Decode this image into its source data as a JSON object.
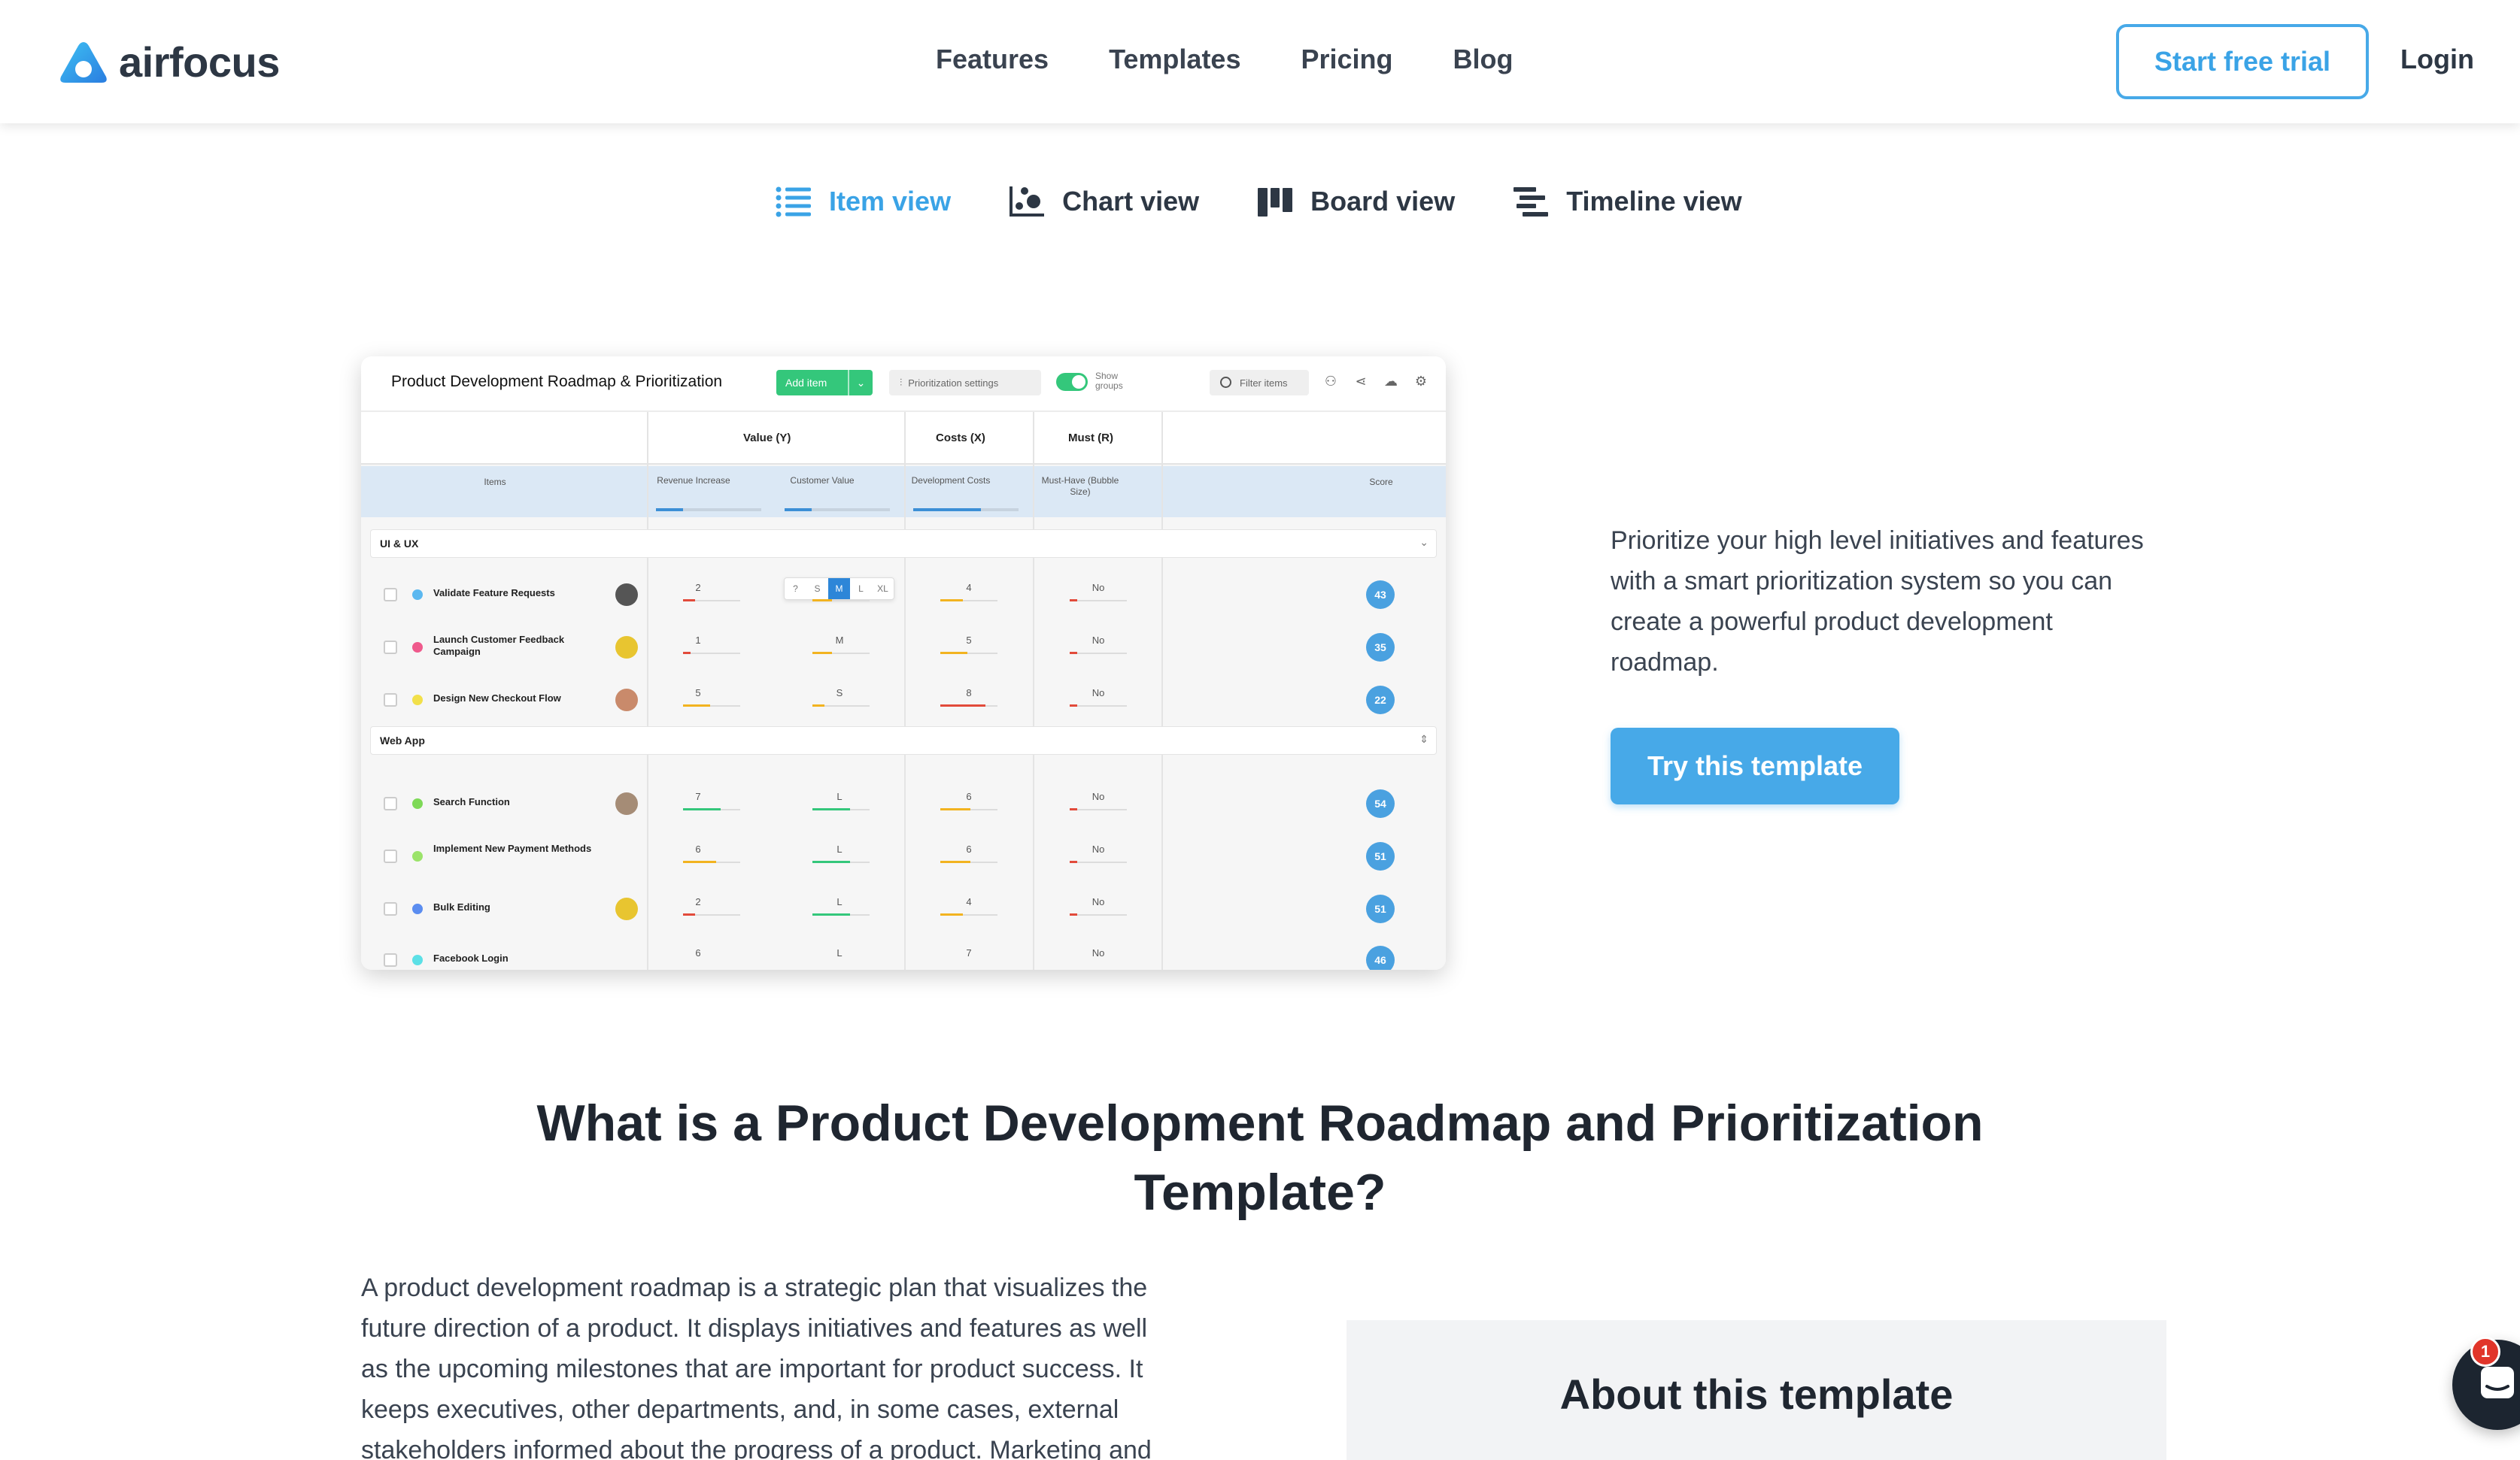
{
  "header": {
    "logo_text": "airfocus",
    "nav": [
      "Features",
      "Templates",
      "Pricing",
      "Blog"
    ],
    "cta": "Start free trial",
    "login": "Login"
  },
  "views": [
    {
      "label": "Item view",
      "icon": "list-icon",
      "active": true
    },
    {
      "label": "Chart view",
      "icon": "chart-icon",
      "active": false
    },
    {
      "label": "Board view",
      "icon": "board-icon",
      "active": false
    },
    {
      "label": "Timeline view",
      "icon": "timeline-icon",
      "active": false
    }
  ],
  "preview": {
    "title": "Product Development Roadmap & Prioritization",
    "add_item": "Add item",
    "prioritization": "Prioritization settings",
    "show_groups": "Show groups",
    "filter": "Filter items",
    "groups_header": {
      "value": "Value (Y)",
      "costs": "Costs (X)",
      "must": "Must (R)"
    },
    "columns": {
      "items": "Items",
      "revenue": "Revenue Increase",
      "customer": "Customer Value",
      "dev": "Development Costs",
      "must": "Must-Have (Bubble Size)",
      "score": "Score"
    },
    "size_options": [
      "?",
      "S",
      "M",
      "L",
      "XL"
    ],
    "group1": "UI & UX",
    "group2": "Web App",
    "items": [
      {
        "name": "Validate Feature Requests",
        "rev": "2",
        "cust": "",
        "dev": "4",
        "must": "No",
        "score": "43",
        "color": "#5bb8f0"
      },
      {
        "name": "Launch Customer Feedback Campaign",
        "rev": "1",
        "cust": "M",
        "dev": "5",
        "must": "No",
        "score": "35",
        "color": "#ef5a8c"
      },
      {
        "name": "Design New Checkout Flow",
        "rev": "5",
        "cust": "S",
        "dev": "8",
        "must": "No",
        "score": "22",
        "color": "#f2e04a"
      },
      {
        "name": "Search Function",
        "rev": "7",
        "cust": "L",
        "dev": "6",
        "must": "No",
        "score": "54",
        "color": "#7ed957"
      },
      {
        "name": "Implement New Payment Methods",
        "rev": "6",
        "cust": "L",
        "dev": "6",
        "must": "No",
        "score": "51",
        "color": "#9be36a"
      },
      {
        "name": "Bulk Editing",
        "rev": "2",
        "cust": "L",
        "dev": "4",
        "must": "No",
        "score": "51",
        "color": "#5b8df0"
      },
      {
        "name": "Facebook Login",
        "rev": "6",
        "cust": "L",
        "dev": "7",
        "must": "No",
        "score": "46",
        "color": "#5ce0e6"
      }
    ]
  },
  "description": "Prioritize your high level initiatives and features with a smart prioritization system so you can create a powerful product development roadmap.",
  "try_button": "Try this template",
  "section": {
    "title": "What is a Product Development Roadmap and Prioritization Template?",
    "paragraph": "A product development roadmap is a strategic plan that visualizes the future direction of a product. It displays initiatives and features as well as the upcoming milestones that are important for product success. It keeps executives, other departments, and, in some cases, external stakeholders informed about the progress of a product. Marketing and",
    "about_title": "About this template"
  },
  "chat_badge": "1",
  "colors": {
    "accent": "#47a9e8",
    "green": "#34c77b",
    "dark": "#1c2530"
  }
}
